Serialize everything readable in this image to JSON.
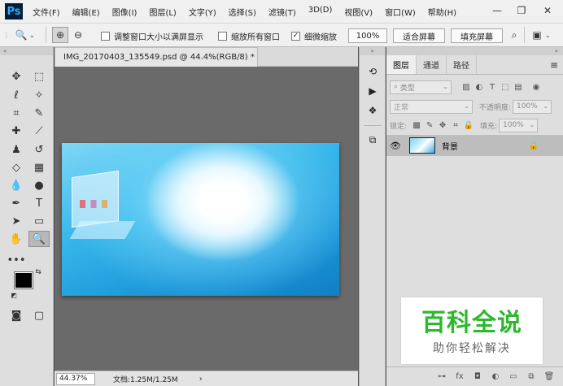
{
  "app": {
    "logo": "Ps",
    "menu": [
      "文件(F)",
      "编辑(E)",
      "图像(I)",
      "图层(L)",
      "文字(Y)",
      "选择(S)",
      "滤镜(T)",
      "3D(D)",
      "视图(V)",
      "窗口(W)",
      "帮助(H)"
    ],
    "window_controls": {
      "minimize": "—",
      "restore": "❐",
      "close": "✕"
    }
  },
  "options": {
    "resize_windows_label": "调整窗口大小以满屏显示",
    "zoom_all_label": "缩放所有窗口",
    "scrubby_zoom_label": "细微缩放",
    "scrubby_zoom_checked": "✓",
    "zoom_value": "100%",
    "fit_screen_label": "适合屏幕",
    "fill_screen_label": "填充屏幕"
  },
  "document": {
    "tab_title": "IMG_20170403_135549.psd @ 44.4%(RGB/8) *",
    "tab_close": "×",
    "status_zoom": "44.37%",
    "status_doc": "文档:1.25M/1.25M",
    "status_arrow": "›"
  },
  "layers_panel": {
    "tabs": [
      "图层",
      "通道",
      "路径"
    ],
    "menu_icon": "≡",
    "filter_kind": "类型",
    "blend_mode": "正常",
    "opacity_label": "不透明度:",
    "opacity_value": "100%",
    "lock_label": "锁定:",
    "fill_label": "填充:",
    "fill_value": "100%",
    "layers": [
      {
        "name": "背景",
        "visible": true,
        "locked": true
      }
    ],
    "footer_icons": [
      "link-icon",
      "fx-icon",
      "mask-icon",
      "adjustment-icon",
      "folder-icon",
      "new-layer-icon",
      "trash-icon"
    ]
  },
  "watermark": {
    "title": "百科全说",
    "subtitle": "助你轻松解决"
  },
  "colors": {
    "ps_logo_bg": "#001e36",
    "ps_logo_fg": "#31a8ff",
    "watermark_title": "#2eb82e",
    "canvas_bg": "#6a6a6a"
  }
}
